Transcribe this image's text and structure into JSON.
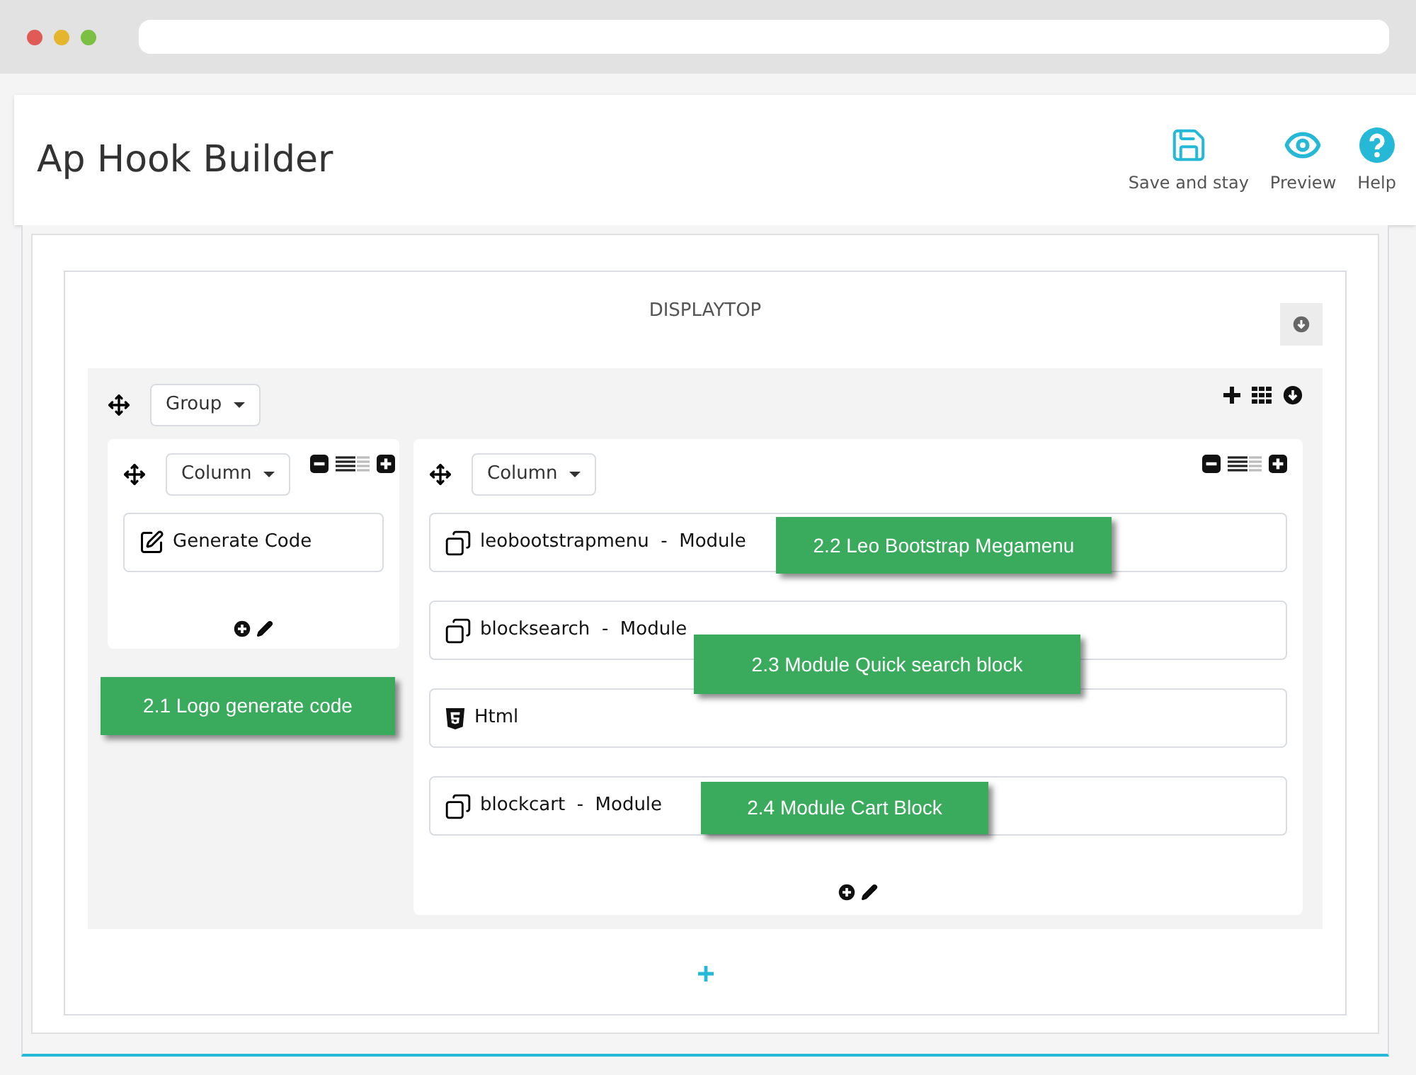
{
  "header": {
    "title": "Ap Hook Builder",
    "actions": [
      {
        "kind": "save",
        "label": "Save and stay"
      },
      {
        "kind": "preview",
        "label": "Preview"
      },
      {
        "kind": "help",
        "label": "Help"
      }
    ]
  },
  "hook": {
    "title": "DISPLAYTOP",
    "group": {
      "label": "Group",
      "columns": [
        {
          "label": "Column",
          "kind": "narrow",
          "items": [
            {
              "kind": "code",
              "label": "Generate Code"
            }
          ]
        },
        {
          "label": "Column",
          "kind": "wide",
          "items": [
            {
              "kind": "module",
              "label": "leobootstrapmenu  -  Module"
            },
            {
              "kind": "module",
              "label": "blocksearch  -  Module"
            },
            {
              "kind": "html",
              "label": "Html"
            },
            {
              "kind": "module",
              "label": "blockcart  -  Module"
            }
          ]
        }
      ]
    },
    "callouts": [
      {
        "text": "2.1 Logo generate code"
      },
      {
        "text": "2.2 Leo Bootstrap Megamenu"
      },
      {
        "text": "2.3 Module Quick search block"
      },
      {
        "text": "2.4 Module Cart Block"
      }
    ]
  }
}
